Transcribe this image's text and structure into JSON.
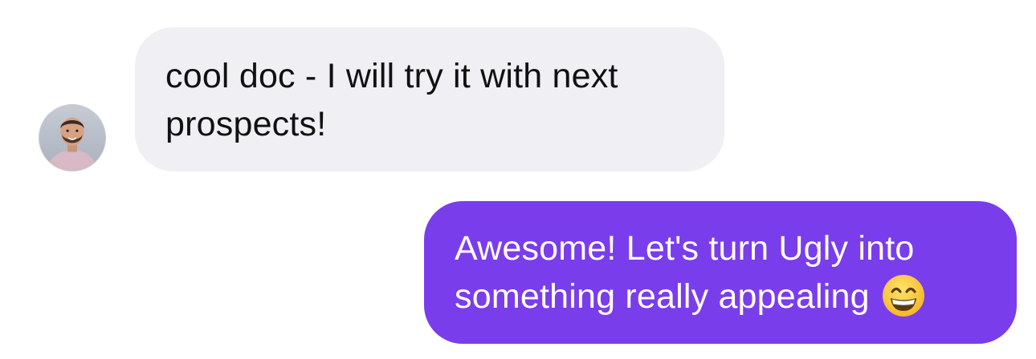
{
  "conversation": {
    "incoming": {
      "avatar_icon": "person-avatar-icon",
      "lines": [
        "cool doc - I will try it with next",
        "prospects!"
      ]
    },
    "outgoing": {
      "lines": [
        "Awesome! Let's turn Ugly into",
        "something really appealing"
      ],
      "emoji_icon": "grinning-face-emoji-icon"
    }
  },
  "colors": {
    "incoming_bubble": "#f0f0f4",
    "outgoing_bubble": "#7a3dec",
    "incoming_text": "#111111",
    "outgoing_text": "#ffffff"
  }
}
